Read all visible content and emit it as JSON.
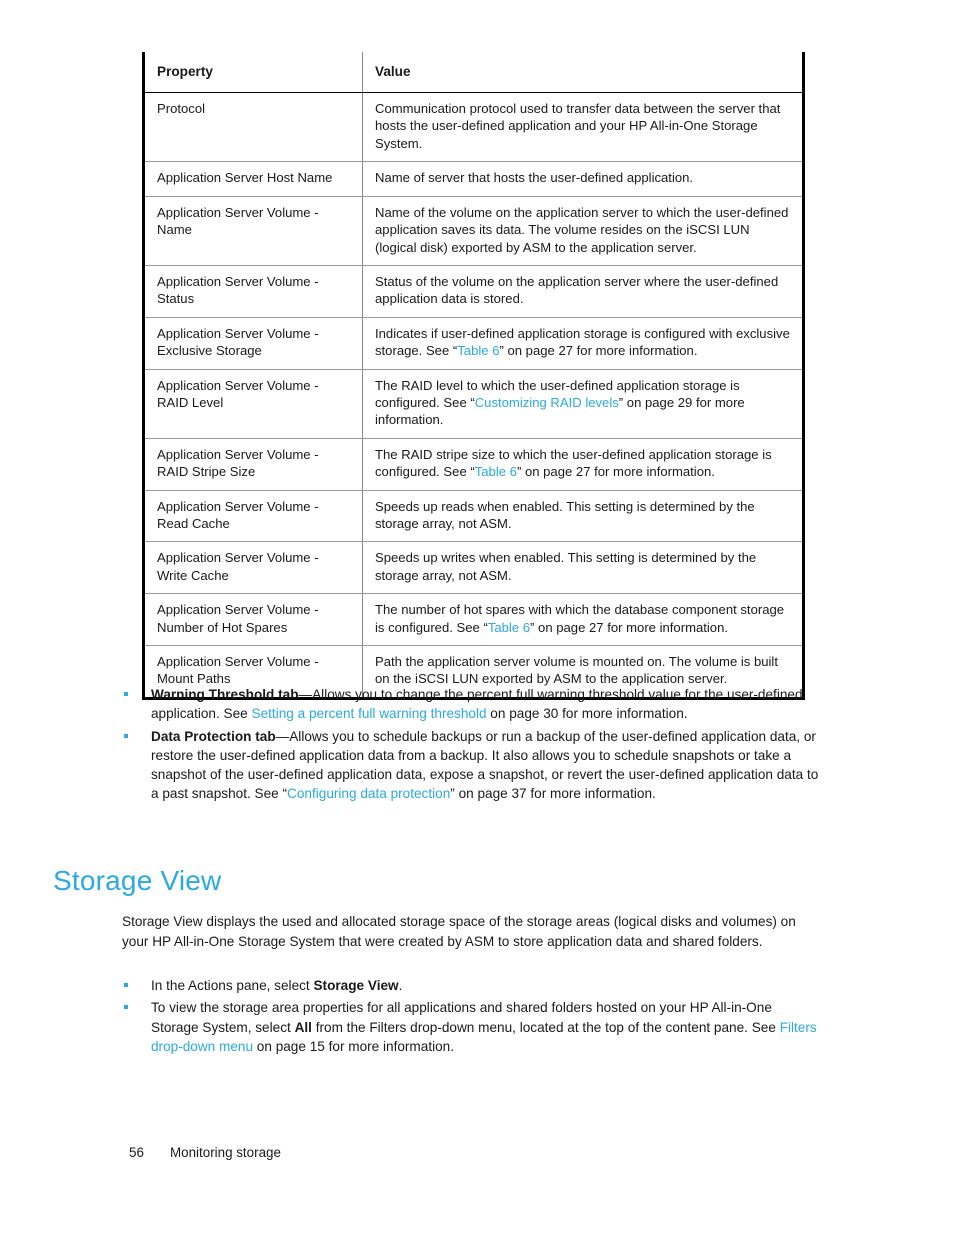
{
  "colors": {
    "link": "#2aaae1",
    "heading": "#2aaae1",
    "text": "#1a1a1a",
    "table_border_heavy": "#000000",
    "table_border_light": "#9a9a9a"
  },
  "table": {
    "headers": [
      "Property",
      "Value"
    ],
    "rows": [
      {
        "property": "Protocol",
        "value_parts": [
          {
            "t": "Communication protocol used to transfer data between the server that hosts the user-defined application and your HP All-in-One Storage System."
          }
        ]
      },
      {
        "property": "Application Server Host Name",
        "value_parts": [
          {
            "t": "Name of server that hosts the user-defined application."
          }
        ]
      },
      {
        "property": "Application Server Volume - Name",
        "value_parts": [
          {
            "t": "Name of the volume on the application server to which the user-defined application saves its data. The volume resides on the iSCSI LUN (logical disk) exported by ASM to the application server."
          }
        ]
      },
      {
        "property": "Application Server Volume - Status",
        "value_parts": [
          {
            "t": "Status of the volume on the application server where the user-defined application data is stored."
          }
        ]
      },
      {
        "property": "Application Server Volume - Exclusive Storage",
        "value_parts": [
          {
            "t": "Indicates if user-defined application storage is configured with exclusive storage. See “"
          },
          {
            "t": "Table 6",
            "link": true
          },
          {
            "t": "” on page 27 for more information."
          }
        ]
      },
      {
        "property": "Application Server Volume - RAID Level",
        "value_parts": [
          {
            "t": "The RAID level to which the user-defined application storage is configured. See “"
          },
          {
            "t": "Customizing RAID levels",
            "link": true
          },
          {
            "t": "” on page 29 for more information."
          }
        ]
      },
      {
        "property": "Application Server Volume - RAID Stripe Size",
        "value_parts": [
          {
            "t": "The RAID stripe size to which the user-defined application storage is configured. See “"
          },
          {
            "t": "Table 6",
            "link": true
          },
          {
            "t": "” on page 27 for more information."
          }
        ]
      },
      {
        "property": "Application Server Volume - Read Cache",
        "value_parts": [
          {
            "t": "Speeds up reads when enabled. This setting is determined by the storage array, not ASM."
          }
        ]
      },
      {
        "property": "Application Server Volume - Write Cache",
        "value_parts": [
          {
            "t": "Speeds up writes when enabled. This setting is determined by the storage array, not ASM."
          }
        ]
      },
      {
        "property": "Application Server Volume - Number of Hot Spares",
        "value_parts": [
          {
            "t": "The number of hot spares with which the database component storage is configured. See “"
          },
          {
            "t": "Table 6",
            "link": true
          },
          {
            "t": "” on page 27 for more information."
          }
        ]
      },
      {
        "property": "Application Server Volume - Mount Paths",
        "value_parts": [
          {
            "t": "Path the application server volume is mounted on. The volume is built on the iSCSI LUN exported by ASM to the application server."
          }
        ]
      }
    ]
  },
  "tab_bullets": [
    {
      "parts": [
        {
          "t": "Warning Threshold tab",
          "bold": true
        },
        {
          "t": "—Allows you to change the percent full warning threshold value for the user-defined application. See "
        },
        {
          "t": "Setting a percent full warning threshold",
          "link": true
        },
        {
          "t": " on page 30 for more information."
        }
      ]
    },
    {
      "parts": [
        {
          "t": "Data Protection tab",
          "bold": true
        },
        {
          "t": "—Allows you to schedule backups or run a backup of the user-defined application data, or restore the user-defined application data from a backup. It also allows you to schedule snapshots or take a snapshot of the user-defined application data, expose a snapshot, or revert the user-defined application data to a past snapshot. See “"
        },
        {
          "t": "Configuring data protection",
          "link": true
        },
        {
          "t": "” on page 37 for more information."
        }
      ]
    }
  ],
  "section": {
    "heading": "Storage View",
    "intro": "Storage View displays the used and allocated storage space of the storage areas (logical disks and volumes) on your HP All-in-One Storage System that were created by ASM to store application data and shared folders.",
    "bullets": [
      {
        "parts": [
          {
            "t": "In the Actions pane, select "
          },
          {
            "t": "Storage View",
            "bold": true
          },
          {
            "t": "."
          }
        ]
      },
      {
        "parts": [
          {
            "t": "To view the storage area properties for all applications and shared folders hosted on your HP All-in-One Storage System, select "
          },
          {
            "t": "All",
            "bold": true
          },
          {
            "t": " from the Filters drop-down menu, located at the top of the content pane. See "
          },
          {
            "t": "Filters drop-down menu",
            "link": true
          },
          {
            "t": " on page 15 for more information."
          }
        ]
      }
    ]
  },
  "footer": {
    "page_number": "56",
    "chapter": "Monitoring storage"
  }
}
